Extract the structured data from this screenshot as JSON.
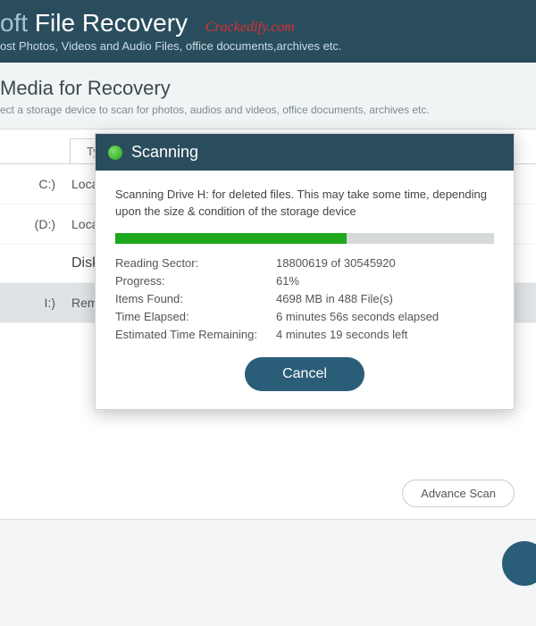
{
  "header": {
    "brand": "oft",
    "product": "File Recovery",
    "watermark": "Crackedify.com",
    "subtitle": "ost Photos, Videos and Audio Files, office documents,archives etc."
  },
  "section": {
    "title": "Media for Recovery",
    "desc": "ect a storage device to scan for photos, audios and videos, office documents, archives etc."
  },
  "tabs": {
    "type": "Type"
  },
  "drives": {
    "row1": {
      "letter": "C:)",
      "type": "Local D"
    },
    "row2": {
      "letter": "(D:)",
      "type": "Local D"
    },
    "group": "Disk",
    "row3": {
      "letter": "I:)",
      "type": "Remov"
    }
  },
  "dialog": {
    "title": "Scanning",
    "message": "Scanning Drive H: for deleted files. This may take some time, depending upon the size & condition of the storage device",
    "progress_percent": 61,
    "stats": {
      "sector_label": "Reading Sector:",
      "sector_value": "18800619 of 30545920",
      "progress_label": "Progress:",
      "progress_value": "61%",
      "items_label": "Items Found:",
      "items_value": "4698 MB in 488 File(s)",
      "elapsed_label": "Time Elapsed:",
      "elapsed_value": "6 minutes 56s seconds elapsed",
      "remaining_label": "Estimated Time Remaining:",
      "remaining_value": "4 minutes 19 seconds left"
    },
    "cancel": "Cancel"
  },
  "buttons": {
    "advance": "Advance Scan"
  }
}
